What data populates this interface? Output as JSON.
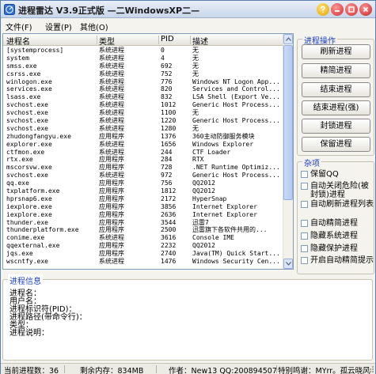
{
  "window": {
    "title": "进程雷达  V3.9正式版  —二WindowsXP二—"
  },
  "menu": [
    "文件(F)",
    "设置(P)",
    "其他(O)"
  ],
  "table": {
    "columns": [
      "进程名",
      "类型",
      "PID",
      "描述"
    ],
    "rows": [
      [
        "[systemprocess]",
        "系统进程",
        "0",
        "无"
      ],
      [
        "system",
        "系统进程",
        "4",
        "无"
      ],
      [
        "smss.exe",
        "系统进程",
        "692",
        "无"
      ],
      [
        "csrss.exe",
        "系统进程",
        "752",
        "无"
      ],
      [
        "winlogon.exe",
        "系统进程",
        "776",
        "Windows NT Logon App..."
      ],
      [
        "services.exe",
        "系统进程",
        "820",
        "Services and Control..."
      ],
      [
        "lsass.exe",
        "系统进程",
        "832",
        "LSA Shell (Export Ve..."
      ],
      [
        "svchost.exe",
        "系统进程",
        "1012",
        "Generic Host Process..."
      ],
      [
        "svchost.exe",
        "系统进程",
        "1100",
        "无"
      ],
      [
        "svchost.exe",
        "系统进程",
        "1220",
        "Generic Host Process..."
      ],
      [
        "svchost.exe",
        "系统进程",
        "1280",
        "无"
      ],
      [
        "zhudongfangyu.exe",
        "应用程序",
        "1376",
        "360主动防御服务模块"
      ],
      [
        "explorer.exe",
        "系统进程",
        "1656",
        "Windows Explorer"
      ],
      [
        "ctfmon.exe",
        "系统进程",
        "244",
        "CTF Loader"
      ],
      [
        "rtx.exe",
        "应用程序",
        "284",
        "RTX"
      ],
      [
        "mscorsvw.exe",
        "应用程序",
        "728",
        ".NET Runtime Optimiz..."
      ],
      [
        "svchost.exe",
        "系统进程",
        "972",
        "Generic Host Process..."
      ],
      [
        "qq.exe",
        "应用程序",
        "756",
        "QQ2012"
      ],
      [
        "txplatform.exe",
        "应用程序",
        "1812",
        "QQ2012"
      ],
      [
        "hprsnap6.exe",
        "应用程序",
        "2172",
        "HyperSnap"
      ],
      [
        "iexplore.exe",
        "应用程序",
        "3856",
        "Internet Explorer"
      ],
      [
        "iexplore.exe",
        "应用程序",
        "2636",
        "Internet Explorer"
      ],
      [
        "thunder.exe",
        "应用程序",
        "3544",
        "迅雷7"
      ],
      [
        "thunderplatform.exe",
        "应用程序",
        "2500",
        "迅雷旗下各软件共用的..."
      ],
      [
        "conime.exe",
        "系统进程",
        "3616",
        "Console IME"
      ],
      [
        "qqexternal.exe",
        "应用程序",
        "2232",
        "QQ2012"
      ],
      [
        "jqs.exe",
        "应用程序",
        "2740",
        "Java(TM) Quick Start..."
      ],
      [
        "wscntfy.exe",
        "系统进程",
        "1476",
        "Windows Security Cen..."
      ]
    ]
  },
  "operations": {
    "title": "进程操作",
    "buttons": [
      "刷新进程",
      "精简进程",
      "结束进程",
      "结束进程(强)",
      "封锁进程",
      "保留进程"
    ]
  },
  "misc": {
    "title": "杂项",
    "checkboxes": [
      "保留QQ",
      "自动关闭危险(被封锁)进程",
      "自动刷新进程列表",
      "自动精简进程",
      "隐藏系统进程",
      "隐藏保护进程",
      "开启自动精简提示"
    ]
  },
  "info": {
    "title": "进程信息",
    "fields": [
      "进程名：",
      "用户名：",
      "进程标识符(PID)：",
      "进程路径(带命令行)：",
      "类型：",
      "进程说明："
    ]
  },
  "status": {
    "process_count": "当前进程数：36",
    "free_memory": "剩余内存：834MB",
    "author": "作者：New13 QQ:200894507",
    "thanks": "特别鸣谢：MYrr。孤云晓风"
  },
  "colors": {
    "accent": "#1d3ebf",
    "title_gradient_top": "#e9eef7",
    "close_button": "#c91818"
  }
}
